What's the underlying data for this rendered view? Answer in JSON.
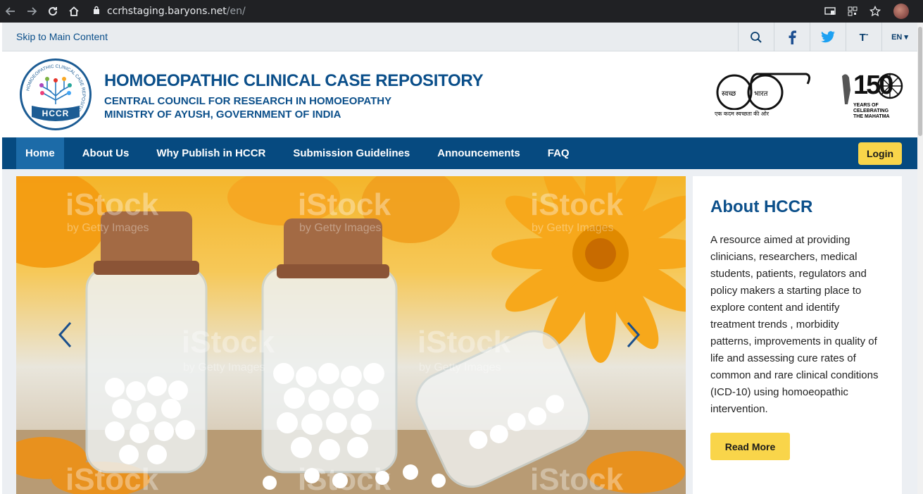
{
  "browser": {
    "url_host": "ccrhstaging.baryons.net",
    "url_path": "/en/"
  },
  "utility": {
    "skip_link": "Skip to Main Content",
    "text_size_label": "T",
    "text_size_suffix": "-",
    "language": "EN"
  },
  "header": {
    "title": "HOMOEOPATHIC CLINICAL CASE REPOSITORY",
    "subtitle1": "CENTRAL COUNCIL FOR RESEARCH IN HOMOEOPATHY",
    "subtitle2": "MINISTRY OF AYUSH, GOVERNMENT OF INDIA",
    "logo_text": "HCCR",
    "logo_ring_text": "HOMOEOPATHIC CLINICAL CASE REPOSITORY",
    "swachh_left": "स्वच्छ",
    "swachh_right": "भारत",
    "swachh_tagline": "एक कदम स्वच्छता की ओर",
    "gandhi_line1": "YEARS OF",
    "gandhi_line2": "CELEBRATING",
    "gandhi_line3": "THE MAHATMA",
    "gandhi_number": "150"
  },
  "nav": {
    "items": [
      {
        "label": "Home"
      },
      {
        "label": "About Us"
      },
      {
        "label": "Why Publish in HCCR"
      },
      {
        "label": "Submission Guidelines"
      },
      {
        "label": "Announcements"
      },
      {
        "label": "FAQ"
      }
    ],
    "login": "Login"
  },
  "slider": {
    "watermark": "iStock",
    "watermark_sub": "by Getty Images"
  },
  "about": {
    "heading": "About HCCR",
    "body": "A resource aimed at providing clinicians, researchers, medical students, patients, regulators and policy makers  a starting place to explore content and identify treatment trends , morbidity patterns, improvements in quality of life and assessing cure rates of common and rare clinical conditions (ICD-10) using homoeopathic intervention.",
    "button": "Read More"
  },
  "colors": {
    "brand_blue": "#0b4f8a",
    "nav_bg": "#064a80",
    "nav_active": "#1c6ba8",
    "accent_yellow": "#f9d54a"
  }
}
